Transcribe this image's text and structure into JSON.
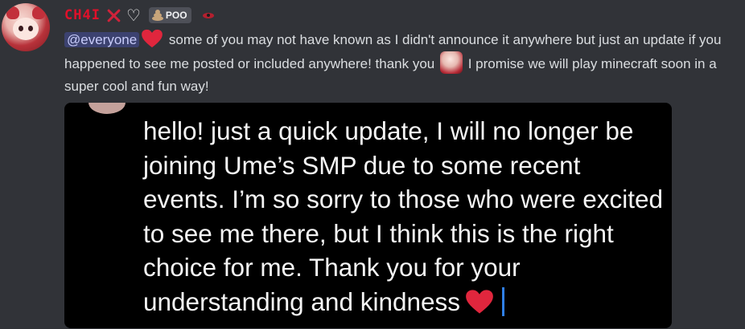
{
  "author": {
    "username": "CH4I",
    "tag": "POO",
    "name_color": "#e0102a",
    "icons": [
      "x-mark-icon",
      "white-heart-icon",
      "poo-icon",
      "eye-emoji-icon"
    ]
  },
  "message": {
    "mention": "@everyone",
    "text_part1": " some of you may not have known as I didn't announce it anywhere but just an update if you happened to see me posted or included anywhere! thank you ",
    "text_part2": " I promise we will play minecraft soon in a super cool and fun way!"
  },
  "attachment": {
    "text": "hello! just a quick update, I will no longer be joining Ume’s SMP due to some recent events. I’m so sorry to those who were excited to see me there, but I think this is the right choice for me. Thank you for your understanding and kindness"
  },
  "colors": {
    "background": "#313338",
    "mention_bg": "#3c4270",
    "mention_text": "#c9cdfb",
    "heart_red": "#e0263d",
    "caret_blue": "#2f7fe8"
  }
}
